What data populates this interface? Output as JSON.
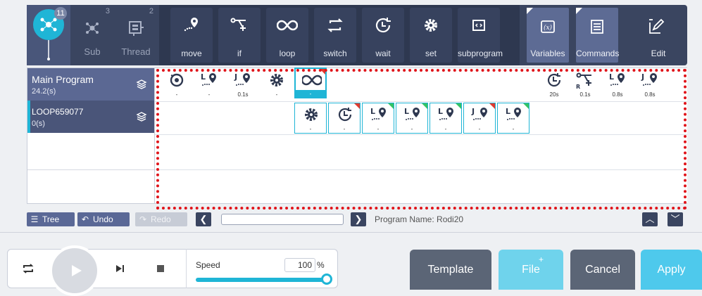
{
  "tabs": {
    "main_count": "11",
    "sub_count": "3",
    "sub_label": "Sub",
    "thread_count": "2",
    "thread_label": "Thread"
  },
  "commands": [
    {
      "label": "move",
      "icon": "move-icon"
    },
    {
      "label": "if",
      "icon": "if-icon"
    },
    {
      "label": "loop",
      "icon": "loop-icon"
    },
    {
      "label": "switch",
      "icon": "switch-icon"
    },
    {
      "label": "wait",
      "icon": "wait-icon"
    },
    {
      "label": "set",
      "icon": "gear-icon"
    },
    {
      "label": "subprogram",
      "icon": "subprogram-icon"
    }
  ],
  "right_tools": [
    {
      "label": "Variables",
      "icon": "variables-icon"
    },
    {
      "label": "Commands",
      "icon": "commands-icon"
    },
    {
      "label": "Edit",
      "icon": "edit-icon"
    }
  ],
  "tree": {
    "main_name": "Main Program",
    "main_time": "24.2(s)",
    "loop_name": "LOOP659077",
    "loop_time": "0(s)"
  },
  "row1_blocks": [
    {
      "icon": "home-icon",
      "value": "-"
    },
    {
      "icon": "move-l-icon",
      "value": "-"
    },
    {
      "icon": "move-j-icon",
      "value": "0.1s"
    },
    {
      "icon": "gear-icon",
      "value": "-"
    },
    {
      "icon": "loop-icon",
      "value": "-"
    },
    {
      "icon": "wait-icon",
      "value": "20s"
    },
    {
      "icon": "if-icon",
      "value": "0.1s"
    },
    {
      "icon": "move-l-icon",
      "value": "0.8s"
    },
    {
      "icon": "move-j-icon",
      "value": "0.8s"
    }
  ],
  "row2_blocks": [
    {
      "icon": "gear-icon",
      "value": "-"
    },
    {
      "icon": "wait-icon",
      "value": "-"
    },
    {
      "icon": "move-l-icon",
      "value": "-"
    },
    {
      "icon": "move-l-icon",
      "value": "-"
    },
    {
      "icon": "move-l-icon",
      "value": "-"
    },
    {
      "icon": "move-j-icon",
      "value": "-"
    },
    {
      "icon": "move-l-icon",
      "value": "-"
    }
  ],
  "nav": {
    "tree": "Tree",
    "undo": "Undo",
    "redo": "Redo",
    "program_name": "Program Name: Rodi20"
  },
  "controls": {
    "speed_label": "Speed",
    "speed_value": "100",
    "speed_unit": "%",
    "speed_fraction": 1.0
  },
  "actions": {
    "template": "Template",
    "file": "File",
    "file_plus": "+",
    "cancel": "Cancel",
    "apply": "Apply"
  },
  "colors": {
    "toolbar": "#3a4560",
    "accent": "#1fb5d6",
    "highlight_border": "#e0141a"
  }
}
